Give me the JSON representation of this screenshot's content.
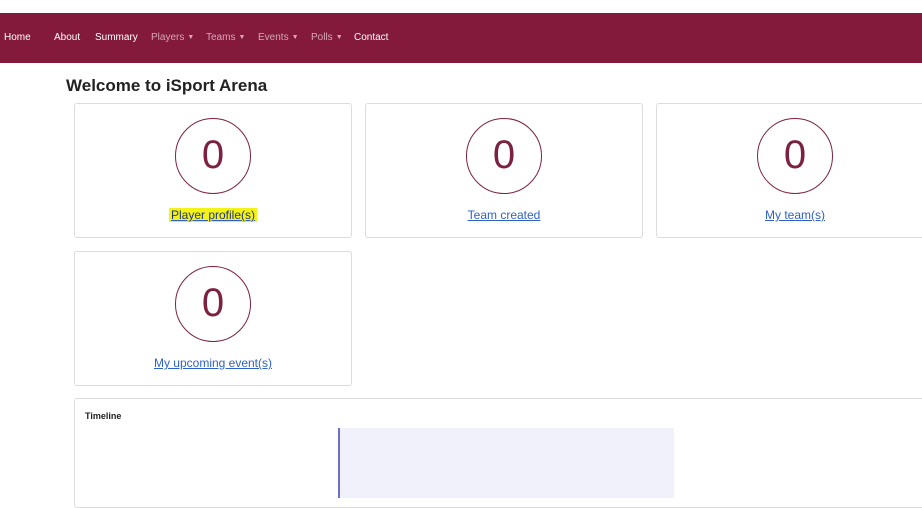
{
  "nav": {
    "items": [
      {
        "label": "Home"
      },
      {
        "label": "About"
      },
      {
        "label": "Summary"
      },
      {
        "label": "Players",
        "caret": "▼"
      },
      {
        "label": "Teams",
        "caret": "▼"
      },
      {
        "label": "Events",
        "caret": "▼"
      },
      {
        "label": "Polls",
        "caret": "▼"
      },
      {
        "label": "Contact"
      }
    ]
  },
  "page": {
    "title": "Welcome to iSport Arena"
  },
  "cards": [
    {
      "count": "0",
      "label": "Player profile(s)",
      "highlighted": true
    },
    {
      "count": "0",
      "label": "Team created"
    },
    {
      "count": "0",
      "label": "My team(s)"
    },
    {
      "count": "0",
      "label": "My upcoming event(s)"
    }
  ],
  "timeline": {
    "title": "Timeline"
  },
  "colors": {
    "navbar": "#831a3c",
    "accent": "#7d2142",
    "link": "#2f61c9",
    "highlight": "#f3f314"
  }
}
